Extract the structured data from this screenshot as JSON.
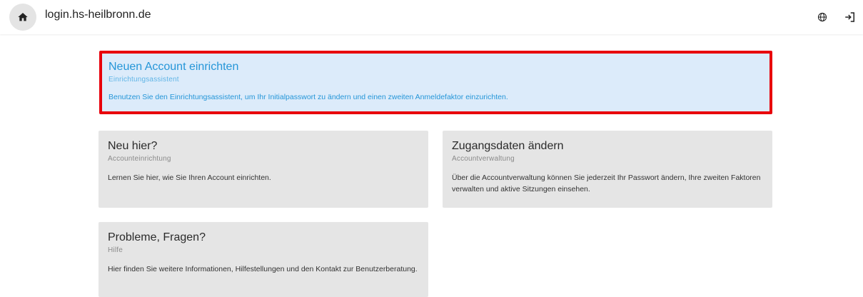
{
  "header": {
    "site_title": "login.hs-heilbronn.de",
    "icons": {
      "home": "home-icon",
      "language": "globe-icon",
      "logout": "logout-icon"
    }
  },
  "cards": {
    "featured": {
      "title": "Neuen Account einrichten",
      "subtitle": "Einrichtungsassistent",
      "description": "Benutzen Sie den Einrichtungsassistent, um Ihr Initialpasswort zu ändern und einen zweiten Anmeldefaktor einzurichten."
    },
    "neu_hier": {
      "title": "Neu hier?",
      "subtitle": "Accounteinrichtung",
      "description": "Lernen Sie hier, wie Sie Ihren Account einrichten."
    },
    "zugangsdaten": {
      "title": "Zugangsdaten ändern",
      "subtitle": "Accountverwaltung",
      "description": "Über die Accountverwaltung können Sie jederzeit Ihr Passwort ändern, Ihre zweiten Faktoren verwalten und aktive Sitzungen einsehen."
    },
    "probleme": {
      "title": "Probleme, Fragen?",
      "subtitle": "Hilfe",
      "description": "Hier finden Sie weitere Informationen, Hilfestellungen und den Kontakt zur Benutzerberatung."
    }
  },
  "colors": {
    "highlight_border": "#e8000b",
    "featured_bg": "#dcebfa",
    "featured_text": "#2596d8",
    "card_bg": "#e5e5e5"
  }
}
